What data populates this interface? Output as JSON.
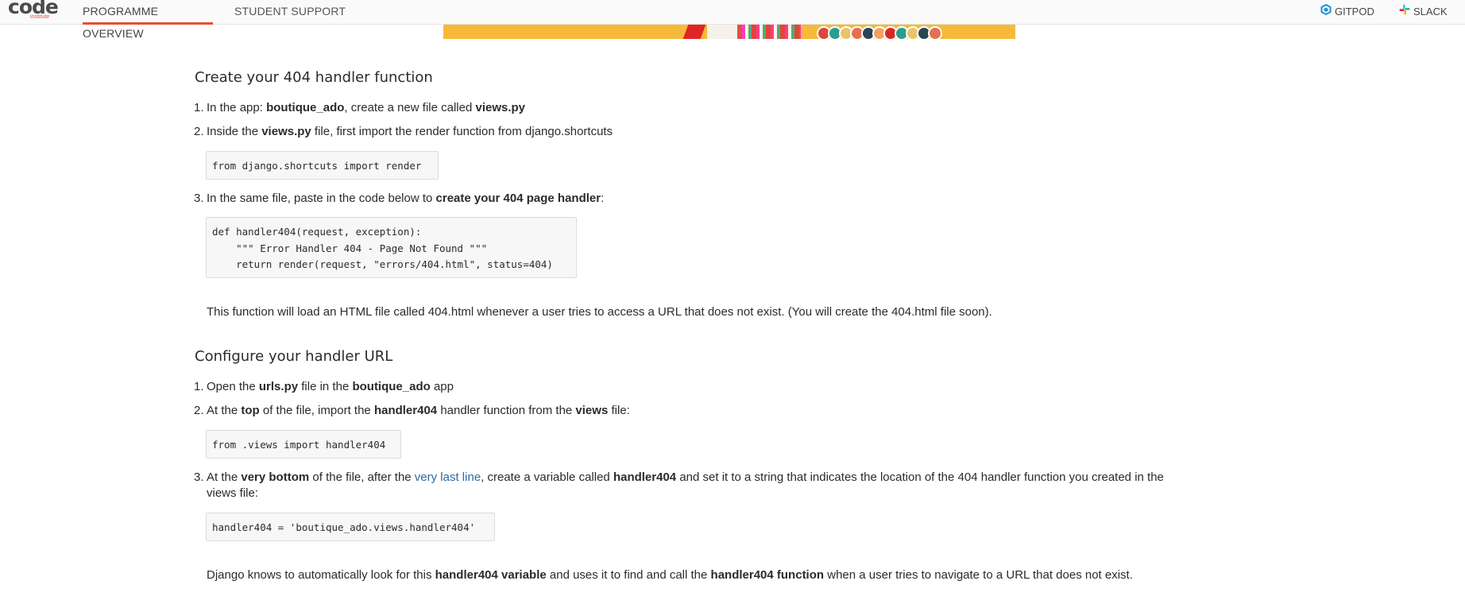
{
  "nav": {
    "logo_text": "code",
    "logo_sub": "institute",
    "tabs": [
      "PROGRAMME OVERVIEW",
      "STUDENT SUPPORT"
    ],
    "right": [
      "GITPOD",
      "SLACK"
    ]
  },
  "section1": {
    "title": "Create your 404 handler function",
    "step1": {
      "num": "1.",
      "a": "In the app: ",
      "b": "boutique_ado",
      "c": ", create a new file called ",
      "d": "views.py"
    },
    "step2": {
      "num": "2.",
      "a": "Inside the ",
      "b": "views.py",
      "c": " file, first import the render function from django.shortcuts"
    },
    "code1": "from django.shortcuts import render",
    "step3": {
      "num": "3.",
      "a": "In the same file, paste in the code below to ",
      "b": "create your 404 page handler",
      "c": ":"
    },
    "code2": "def handler404(request, exception):\n    \"\"\" Error Handler 404 - Page Not Found \"\"\"\n    return render(request, \"errors/404.html\", status=404)",
    "note": "This function will load an HTML file called 404.html whenever a user tries to access a URL that does not exist. (You will create the 404.html file soon)."
  },
  "section2": {
    "title": "Configure your handler URL",
    "step1": {
      "num": "1.",
      "a": "Open the ",
      "b": "urls.py",
      "c": " file in the ",
      "d": "boutique_ado",
      "e": " app"
    },
    "step2": {
      "num": "2.",
      "a": "At the ",
      "b": "top",
      "c": " of the file, import the ",
      "d": "handler404",
      "e": " handler function from the ",
      "f": "views",
      "g": " file:"
    },
    "code1": "from .views import handler404",
    "step3": {
      "num": "3.",
      "a": "At the ",
      "b": "very bottom",
      "c": " of the file, after the ",
      "link": "very last line",
      "d": ", create a variable called ",
      "e": "handler404",
      "f": " and set it to a string that indicates the location of the 404 handler function you created in the",
      "g": "views file:"
    },
    "code2": "handler404 = 'boutique_ado.views.handler404'",
    "note": {
      "a": "Django knows to automatically look for this ",
      "b": "handler404 variable",
      "c": " and uses it to find and call the ",
      "d": "handler404 function",
      "e": " when a user tries to navigate to a URL that does not exist."
    }
  }
}
